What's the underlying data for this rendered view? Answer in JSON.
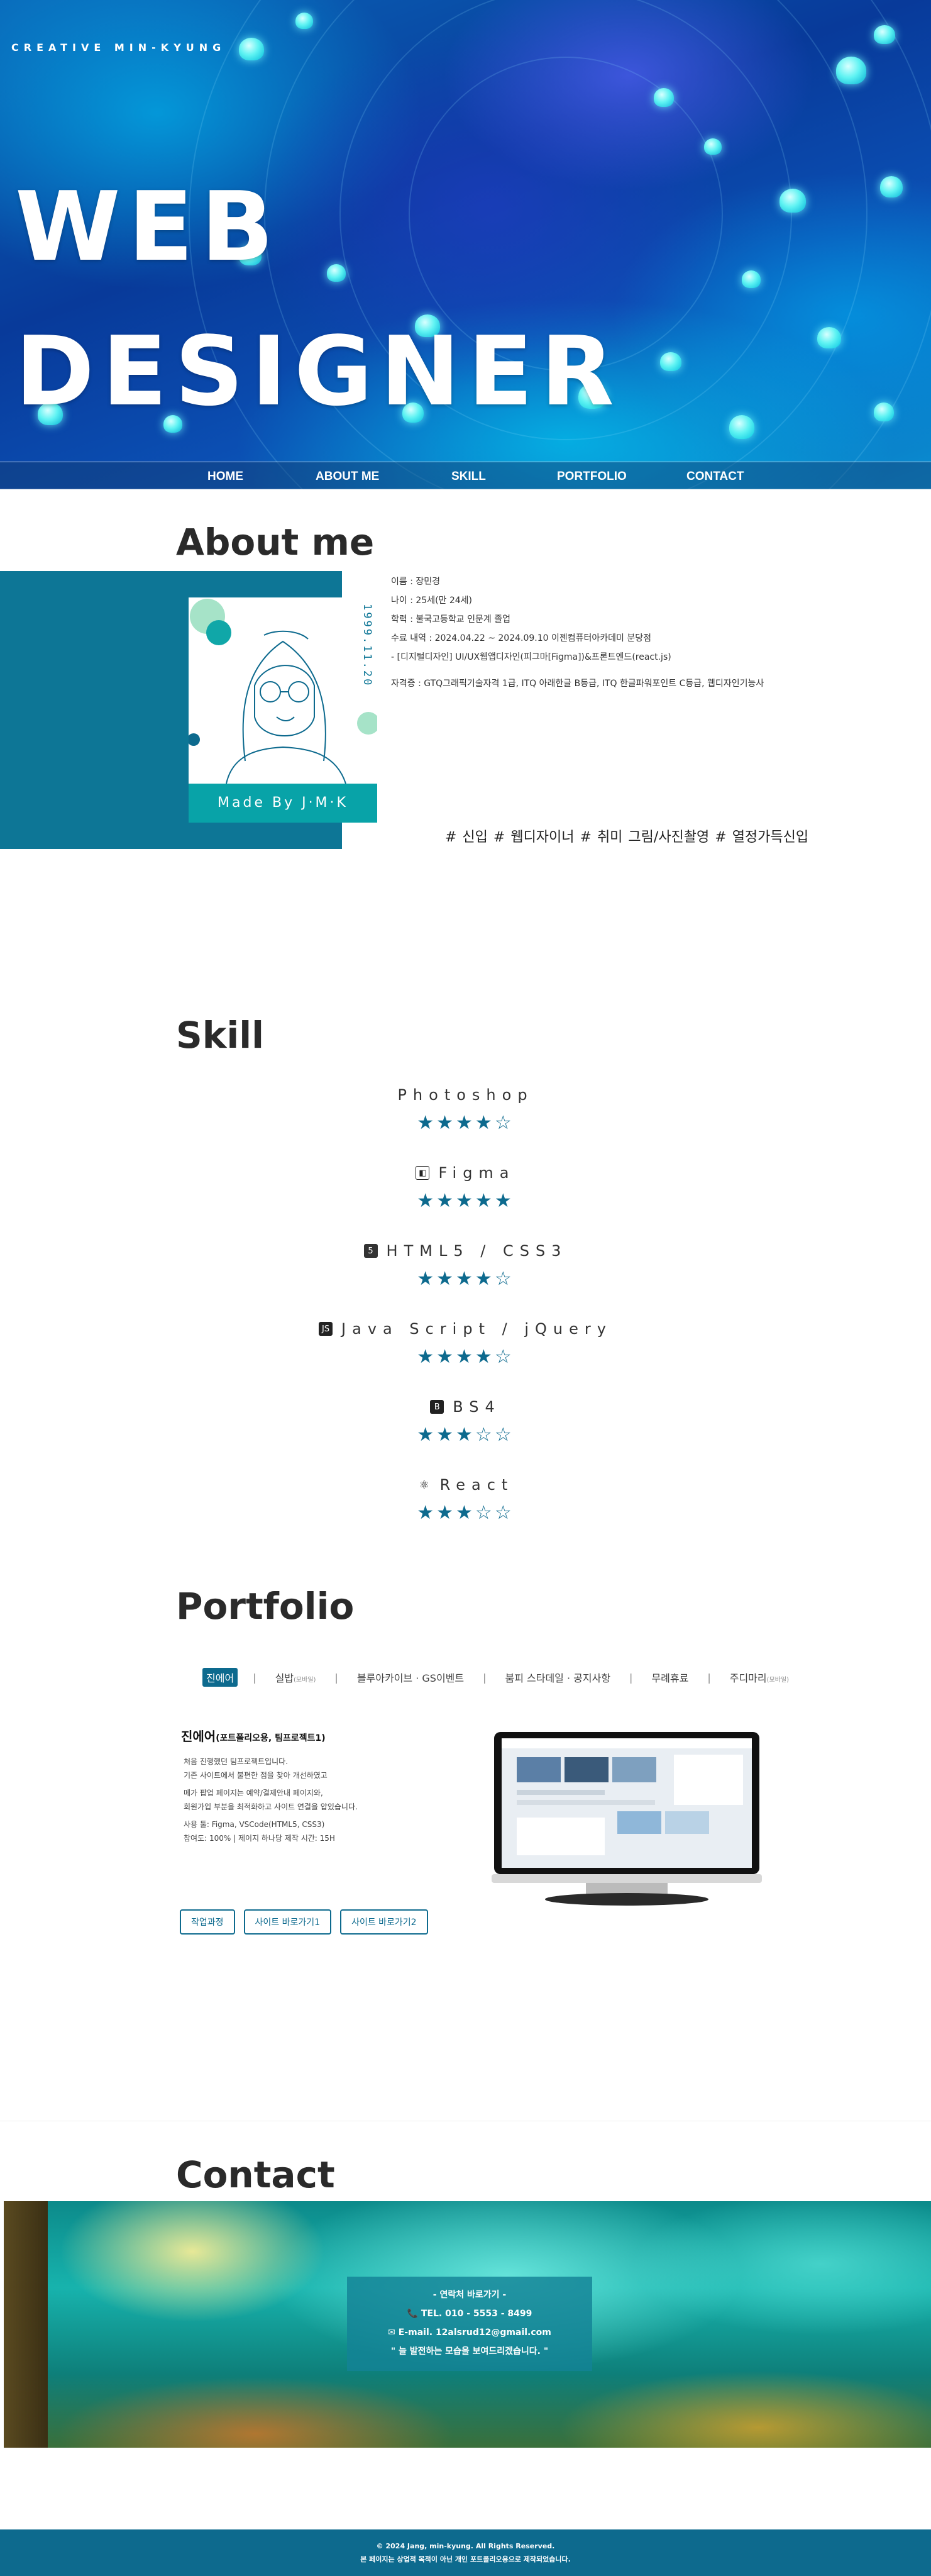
{
  "brand": "CREATIVE MIN-KYUNG",
  "hero": {
    "line1": "WEB",
    "line2": "DESIGNER"
  },
  "nav": {
    "items": [
      "HOME",
      "ABOUT ME",
      "SKILL",
      "PORTFOLIO",
      "CONTACT"
    ]
  },
  "about": {
    "title": "About me",
    "caption": "Made By J·M·K",
    "birth": "1999.11.20",
    "info": [
      "이름 : 장민경",
      "나이 : 25세(만 24세)",
      "학력 : 불국고등학교 인문계 졸업",
      "수료 내역 : 2024.04.22 ~ 2024.09.10 이젠컴퓨터아카데미 분당점",
      "- [디지털디자인] UI/UX웹앱디자인(피그마[Figma])&프론트엔드(react.js)",
      "자격증 : GTQ그래픽기술자격 1급, ITQ 아래한글 B등급, ITQ 한글파워포인트 C등급, 웹디자인기능사"
    ],
    "tags": "# 신입   # 웹디자이너   # 취미 그림/사진촬영   # 열정가득신입"
  },
  "skill": {
    "title": "Skill",
    "items": [
      {
        "name": "Photoshop",
        "stars": "★★★★☆",
        "icon": ""
      },
      {
        "name": "Figma",
        "stars": "★★★★★",
        "icon": "figma-icon"
      },
      {
        "name": "HTML5 / CSS3",
        "stars": "★★★★☆",
        "icon": "html5-icon"
      },
      {
        "name": "Java Script / jQuery",
        "stars": "★★★★☆",
        "icon": "js-icon"
      },
      {
        "name": "BS4",
        "stars": "★★★☆☆",
        "icon": "bootstrap-icon"
      },
      {
        "name": "React",
        "stars": "★★★☆☆",
        "icon": "react-icon"
      }
    ]
  },
  "portfolio": {
    "title": "Portfolio",
    "tabs": [
      {
        "label": "진에어",
        "sub": ""
      },
      {
        "label": "실밥",
        "sub": "(모바일)"
      },
      {
        "label": "블루아카이브 · GS이벤트",
        "sub": ""
      },
      {
        "label": "붐피 스타데일 · 공지사항",
        "sub": ""
      },
      {
        "label": "무례휴료",
        "sub": ""
      },
      {
        "label": "주디마리",
        "sub": "(모바일)"
      }
    ],
    "project_title": "진에어",
    "project_sub": "(포트폴리오용, 팀프로젝트1)",
    "desc": [
      "처음 진행했던 팀프로젝트입니다.",
      "기존 사이트에서 불편한 점을 찾아 개선하였고",
      "",
      "메가 팝업 페이지는 예약/결제안내 페이지와,",
      "회원가입 부분을 최적화하고 사이트 연결을 압있습니다.",
      "",
      "사용 툴: Figma, VSCode(HTML5, CSS3)",
      "참여도: 100% | 제이지 하나당 제작 시간: 15H"
    ],
    "buttons": [
      "작업과정",
      "사이트 바로가기1",
      "사이트 바로가기2"
    ]
  },
  "contact": {
    "title": "Contact",
    "box": [
      "- 연락처 바로가기 -",
      "📞 TEL. 010 - 5553 - 8499",
      "✉ E-mail. 12alsrud12@gmail.com",
      "\" 늘 발전하는 모습을 보여드리겠습니다. \""
    ]
  },
  "footer": {
    "line1": "© 2024 Jang, min-kyung. All Rights Reserved.",
    "line2": "본 페이지는 상업적 목적이 아닌 개인 포트폴리오용으로 제작되었습니다."
  },
  "colors": {
    "accent": "#0d6a8e",
    "teal": "#08a3a8",
    "band": "#0d7696"
  }
}
